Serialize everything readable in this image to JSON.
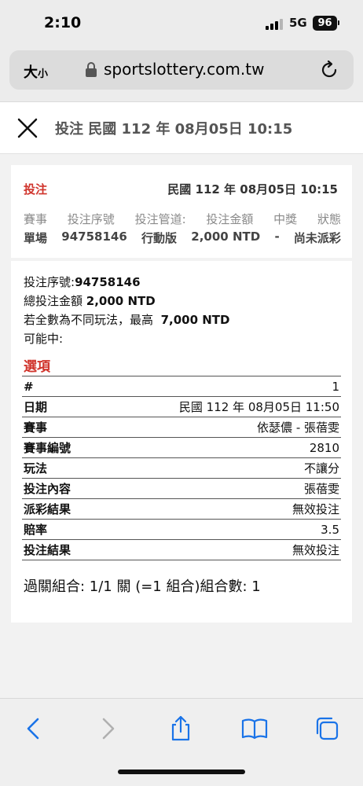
{
  "status_bar": {
    "time": "2:10",
    "network": "5G",
    "battery": "96"
  },
  "browser": {
    "text_size_label": "大",
    "text_size_small": "小",
    "url": "sportslottery.com.tw"
  },
  "header": {
    "title": "投注 民國 112 年 08月05日 10:15"
  },
  "summary": {
    "label": "投注",
    "date": "民國 112 年 08月05日 10:15",
    "columns": [
      "賽事",
      "投注序號",
      "投注管道:",
      "投注金額",
      "中獎",
      "狀態"
    ],
    "values": [
      "單場",
      "94758146",
      "行動版",
      "2,000 NTD",
      "-",
      "尚未派彩"
    ]
  },
  "detail": {
    "serial_label": "投注序號:",
    "serial_value": "94758146",
    "total_label": "總投注金額",
    "total_value": "2,000 NTD",
    "max_label": "若全數為不同玩法，最高",
    "max_value": "7,000 NTD",
    "possible_label": "可能中:",
    "options_label": "選項",
    "rows": [
      {
        "key": "#",
        "value": "1"
      },
      {
        "key": "日期",
        "value": "民國 112 年 08月05日 11:50"
      },
      {
        "key": "賽事",
        "value": "依瑟儂 - 張蓓雯"
      },
      {
        "key": "賽事編號",
        "value": "2810"
      },
      {
        "key": "玩法",
        "value": "不讓分"
      },
      {
        "key": "投注內容",
        "value": "張蓓雯"
      },
      {
        "key": "派彩結果",
        "value": "無效投注"
      },
      {
        "key": "賠率",
        "value": "3.5"
      },
      {
        "key": "投注結果",
        "value": "無效投注"
      }
    ],
    "combo_text": "過關組合: 1/1 關 (=1 組合)組合數: 1"
  },
  "colors": {
    "accent_red": "#d0342c",
    "ios_blue": "#1a73e8"
  }
}
